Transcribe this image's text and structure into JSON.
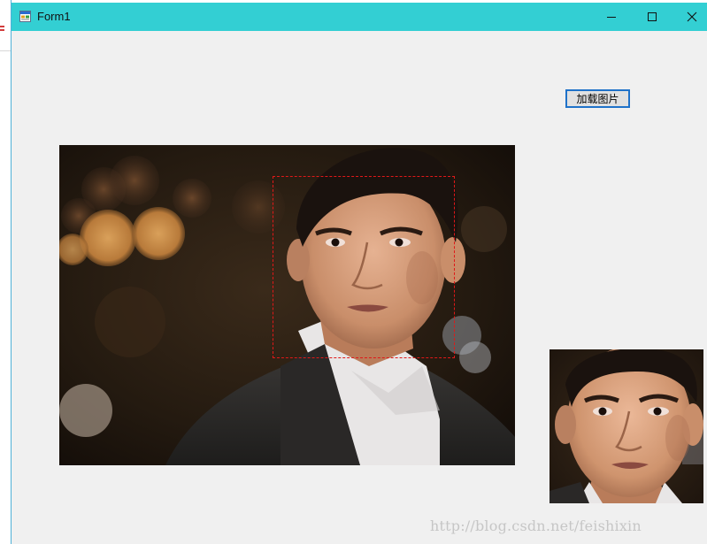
{
  "window": {
    "title": "Form1",
    "icon": "winforms-app-icon",
    "controls": {
      "minimize_icon": "minimize-icon",
      "maximize_icon": "maximize-icon",
      "close_icon": "close-icon"
    }
  },
  "toolbar": {
    "load_image_label": "加载图片"
  },
  "pictures": {
    "main": {
      "content": "portrait-photo",
      "face_box_color": "#e01818"
    },
    "crop": {
      "content": "face-crop-photo"
    }
  },
  "watermark": {
    "text": "http://blog.csdn.net/feishixin"
  },
  "colors": {
    "titlebar": "#33cfd3",
    "client": "#f0f0f0",
    "button_border": "#1f72c9",
    "face_box": "#e01818"
  }
}
